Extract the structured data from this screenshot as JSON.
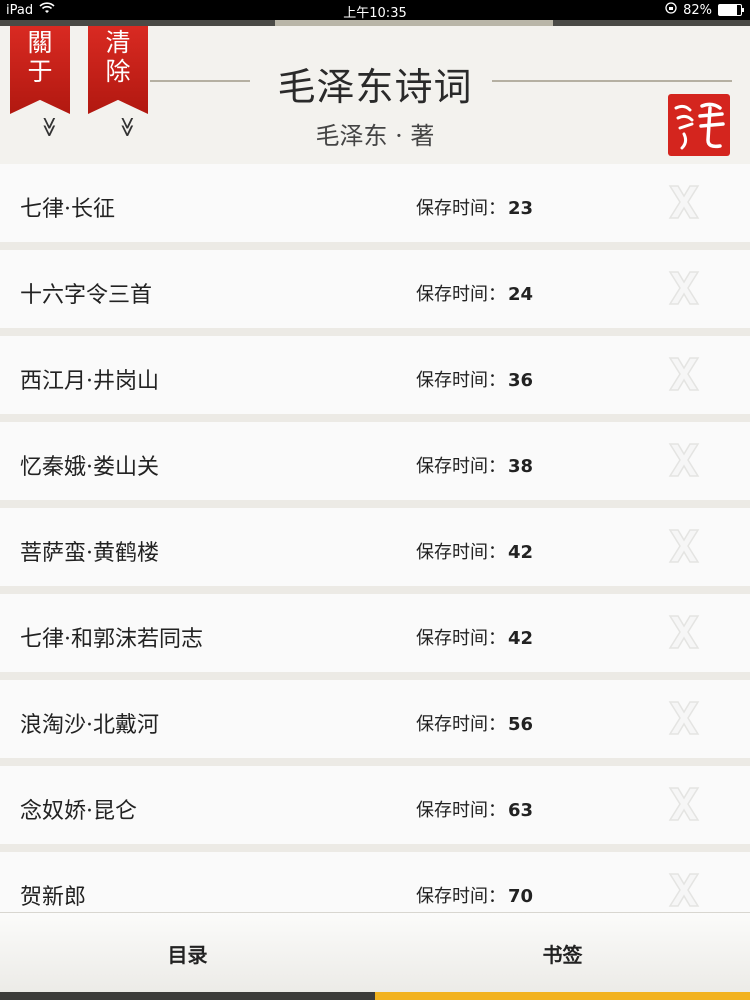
{
  "status_bar": {
    "device": "iPad",
    "time": "上午10:35",
    "battery": "82%",
    "battery_level": 0.82
  },
  "reading_progress": 0.37,
  "header": {
    "title": "毛泽东诗词",
    "author": "毛泽东 · 著",
    "about_button": [
      "關",
      "于"
    ],
    "clear_button": [
      "清",
      "除"
    ],
    "about_chevron": "≫",
    "clear_chevron": "≫",
    "seal_icon": "red-calligraphy-seal-icon"
  },
  "list": {
    "saved_label": "保存时间：",
    "items": [
      {
        "name": "七律·长征",
        "time": "23"
      },
      {
        "name": "十六字令三首",
        "time": "24"
      },
      {
        "name": "西江月·井岗山",
        "time": "36"
      },
      {
        "name": "忆秦娥·娄山关",
        "time": "38"
      },
      {
        "name": "菩萨蛮·黄鹤楼",
        "time": "42"
      },
      {
        "name": "七律·和郭沫若同志",
        "time": "42"
      },
      {
        "name": "浪淘沙·北戴河",
        "time": "56"
      },
      {
        "name": "念奴娇·昆仑",
        "time": "63"
      },
      {
        "name": "贺新郎",
        "time": "70"
      }
    ]
  },
  "tabs": {
    "toc": "目录",
    "bookmarks": "书签",
    "active": "bookmarks"
  },
  "colors": {
    "ribbon_red": "#c81f17",
    "active_tab": "#f2b21f"
  }
}
